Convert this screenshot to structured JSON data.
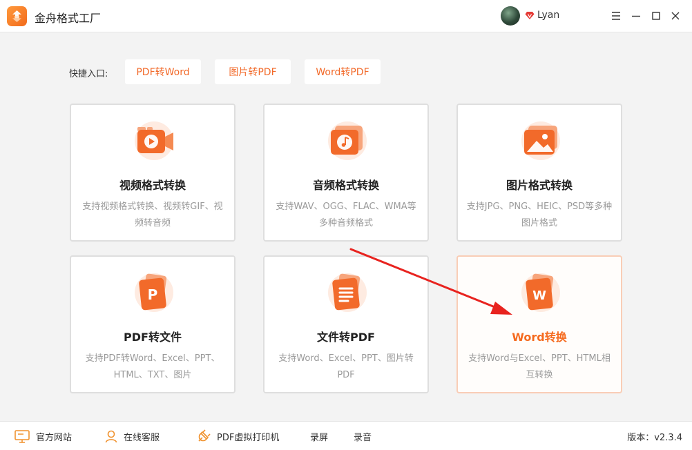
{
  "app": {
    "title": "金舟格式工厂"
  },
  "user": {
    "name": "Lyan"
  },
  "quick_entry": {
    "label": "快捷入口:",
    "buttons": [
      "PDF转Word",
      "图片转PDF",
      "Word转PDF"
    ]
  },
  "cards": [
    {
      "title": "视频格式转换",
      "desc": "支持视频格式转换、视频转GIF、视频转音频",
      "icon": "video-icon"
    },
    {
      "title": "音频格式转换",
      "desc": "支持WAV、OGG、FLAC、WMA等多种音频格式",
      "icon": "music-icon"
    },
    {
      "title": "图片格式转换",
      "desc": "支持JPG、PNG、HEIC、PSD等多种图片格式",
      "icon": "image-icon"
    },
    {
      "title": "PDF转文件",
      "desc": "支持PDF转Word、Excel、PPT、HTML、TXT、图片",
      "icon": "ppt-icon"
    },
    {
      "title": "文件转PDF",
      "desc": "支持Word、Excel、PPT、图片转PDF",
      "icon": "document-icon"
    },
    {
      "title": "Word转换",
      "desc": "支持Word与Excel、PPT、HTML相互转换",
      "icon": "word-icon"
    }
  ],
  "bottom": {
    "website": "官方网站",
    "service": "在线客服",
    "printer": "PDF虚拟打印机",
    "record_screen": "录屏",
    "record_audio": "录音",
    "version": "版本：v2.3.4"
  },
  "colors": {
    "accent": "#f56a1e",
    "background": "#f3f3f3"
  }
}
